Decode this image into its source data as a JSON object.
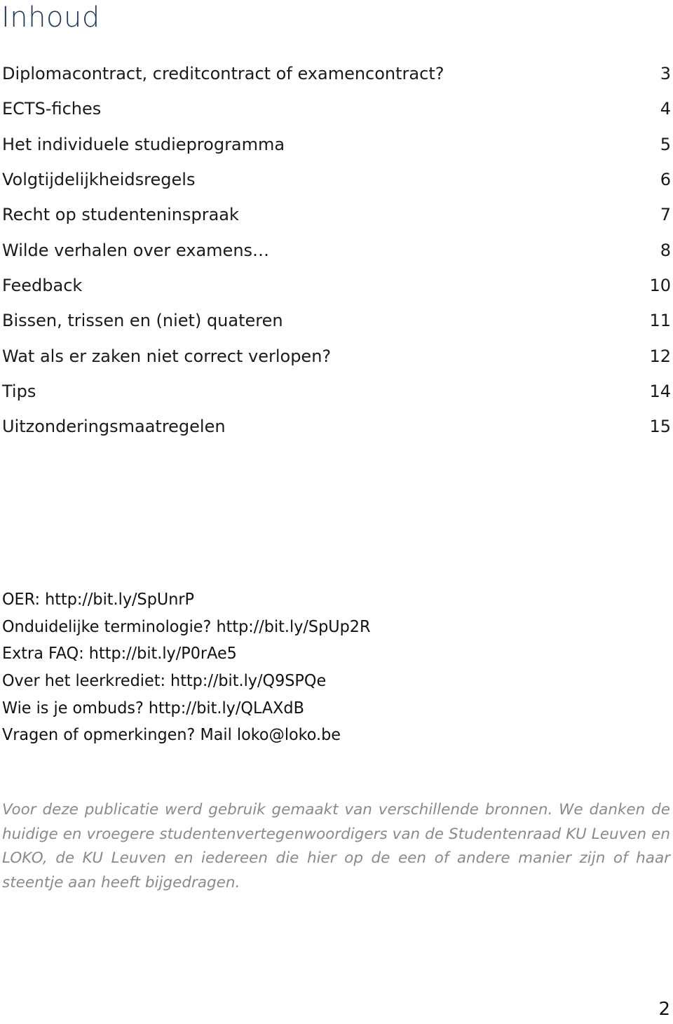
{
  "document": {
    "title": "Inhoud",
    "toc": [
      {
        "label": "Diplomacontract, creditcontract of examencontract?",
        "page": "3"
      },
      {
        "label": "ECTS-fiches",
        "page": "4"
      },
      {
        "label": "Het individuele studieprogramma",
        "page": "5"
      },
      {
        "label": "Volgtijdelijkheidsregels",
        "page": "6"
      },
      {
        "label": "Recht op studenteninspraak",
        "page": "7"
      },
      {
        "label": "Wilde verhalen over examens…",
        "page": "8"
      },
      {
        "label": "Feedback",
        "page": "10"
      },
      {
        "label": "Bissen, trissen en (niet) quateren",
        "page": "11"
      },
      {
        "label": "Wat als er zaken niet correct verlopen?",
        "page": "12"
      },
      {
        "label": "Tips",
        "page": "14"
      },
      {
        "label": "Uitzonderingsmaatregelen",
        "page": "15"
      }
    ],
    "links": [
      "OER: http://bit.ly/SpUnrP",
      "Onduidelijke terminologie? http://bit.ly/SpUp2R",
      "Extra FAQ: http://bit.ly/P0rAe5",
      "Over het leerkrediet: http://bit.ly/Q9SPQe",
      "Wie is je ombuds? http://bit.ly/QLAXdB",
      "Vragen of opmerkingen? Mail loko@loko.be"
    ],
    "credits": "Voor deze publicatie werd gebruik gemaakt van verschillende bronnen. We danken de huidige en vroegere studentenvertegenwoordigers van de Studentenraad KU Leuven en LOKO, de KU Leuven en iedereen die hier op de een of andere manier zijn of haar steentje aan heeft bijgedragen.",
    "page_number": "2"
  }
}
